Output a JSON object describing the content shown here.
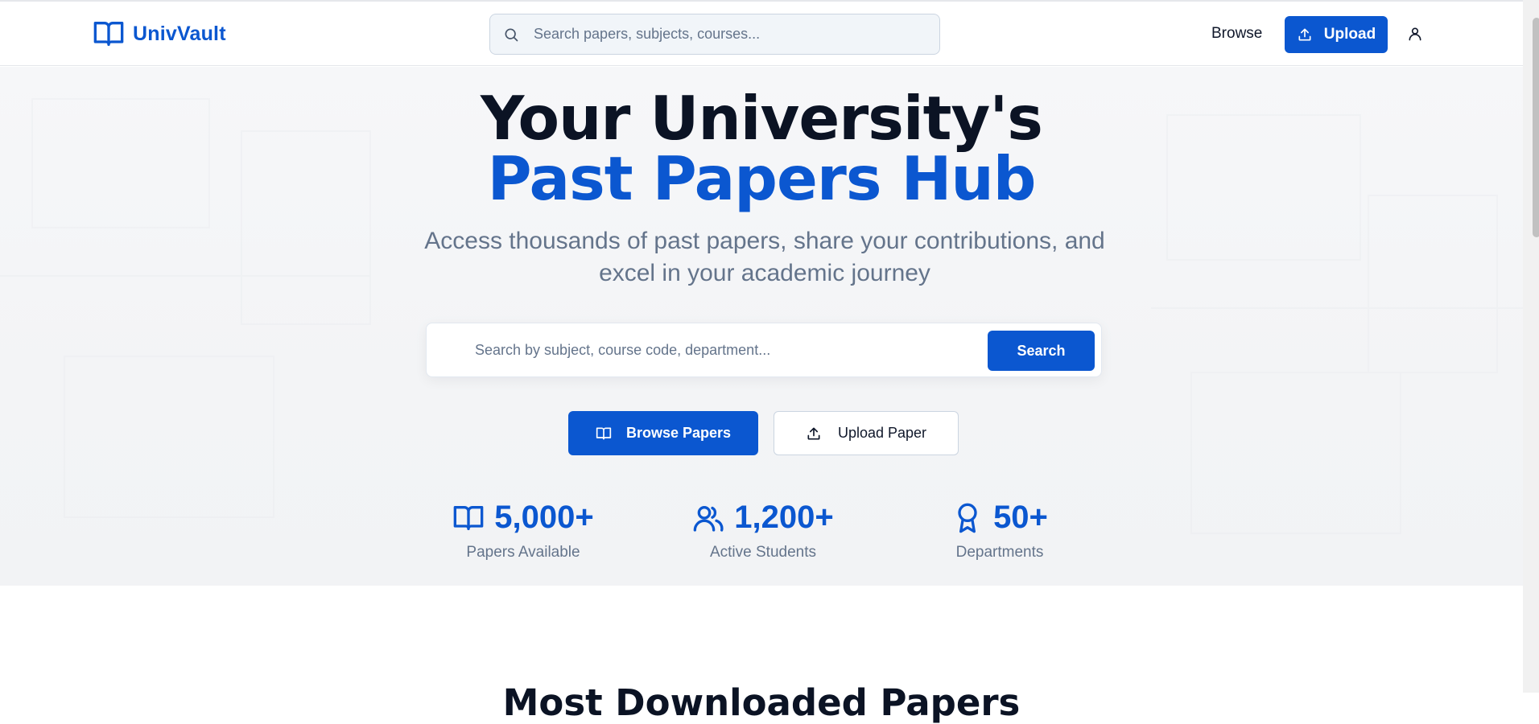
{
  "app": {
    "name": "UnivVault"
  },
  "header": {
    "search_placeholder": "Search papers, subjects, courses...",
    "nav_browse": "Browse",
    "upload_label": "Upload"
  },
  "hero": {
    "title_line1": "Your University's",
    "title_line2": "Past Papers Hub",
    "subtitle": "Access thousands of past papers, share your contributions, and excel in your academic journey",
    "search_placeholder": "Search by subject, course code, department...",
    "search_button": "Search",
    "browse_button": "Browse Papers",
    "upload_button": "Upload Paper"
  },
  "stats": [
    {
      "icon": "book-open-icon",
      "value": "5,000+",
      "label": "Papers Available"
    },
    {
      "icon": "users-icon",
      "value": "1,200+",
      "label": "Active Students"
    },
    {
      "icon": "award-icon",
      "value": "50+",
      "label": "Departments"
    }
  ],
  "sections": {
    "most_downloaded_title": "Most Downloaded Papers"
  },
  "colors": {
    "brand": "#0b57d0",
    "text_dark": "#0b1324",
    "muted": "#64748b"
  }
}
